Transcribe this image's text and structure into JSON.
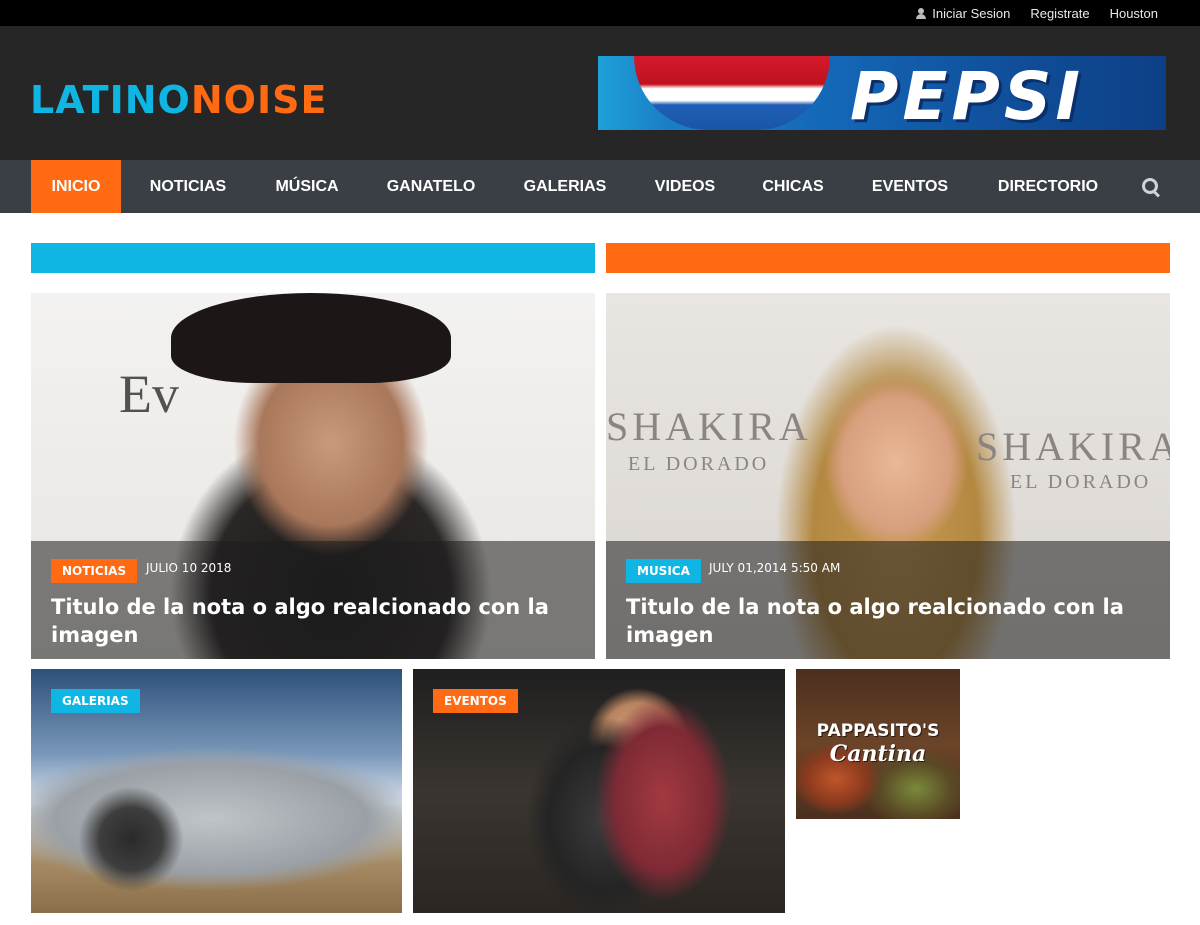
{
  "topbar": {
    "login": "Iniciar Sesion",
    "register": "Registrate",
    "city": "Houston"
  },
  "header": {
    "logo_part1": "LATINO",
    "logo_part2": "NOISE",
    "ad_text": "PEPSI"
  },
  "nav": {
    "items": [
      {
        "label": "INICIO"
      },
      {
        "label": "NOTICIAS"
      },
      {
        "label": "MÚSICA"
      },
      {
        "label": "GANATELO"
      },
      {
        "label": "GALERIAS"
      },
      {
        "label": "VIDEOS"
      },
      {
        "label": "CHICAS"
      },
      {
        "label": "EVENTOS"
      },
      {
        "label": "DIRECTORIO"
      }
    ],
    "active": "INICIO"
  },
  "colors": {
    "brand_blue": "#0fb6e3",
    "brand_orange": "#ff6a13",
    "nav_bg": "#3a3f45",
    "header_bg": "#262626"
  },
  "features": [
    {
      "tag": "NOTICIAS",
      "tag_color": "orange",
      "date": "JULIO 10 2018",
      "title": "Titulo de la nota o algo realcionado con la imagen",
      "bg_text": "Ev"
    },
    {
      "tag": "MUSICA",
      "tag_color": "blue",
      "date": "JULY 01,2014 5:50 AM",
      "title": "Titulo de la nota o algo realcionado con la imagen",
      "bg_text_1": "SHAKIRA",
      "bg_text_2": "EL DORADO"
    }
  ],
  "secondary": [
    {
      "tag": "GALERIAS",
      "tag_color": "blue"
    },
    {
      "tag": "EVENTOS",
      "tag_color": "orange"
    }
  ],
  "side_ad": {
    "line1": "PAPPASITO'S",
    "line2": "Cantina"
  },
  "icons": [
    "user-icon",
    "search-icon"
  ]
}
